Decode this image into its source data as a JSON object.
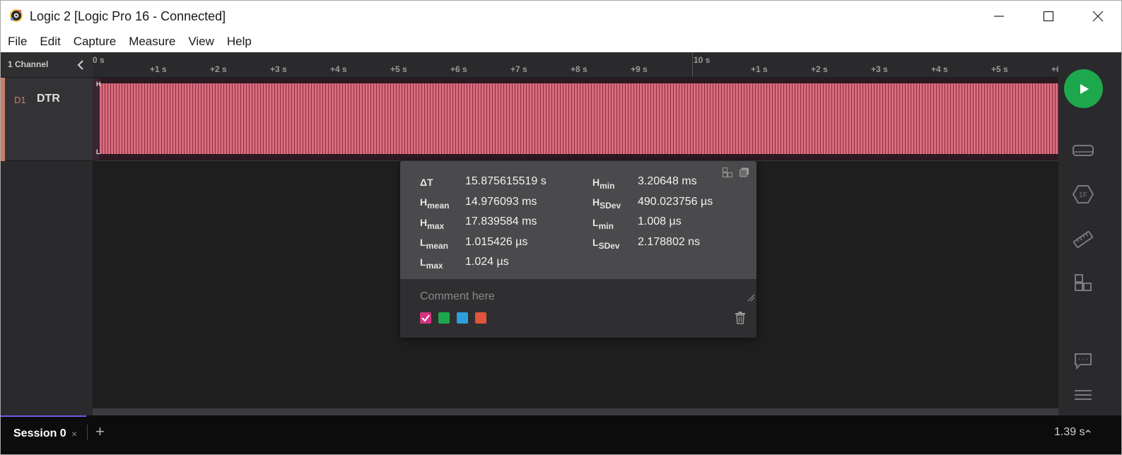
{
  "window": {
    "title": "Logic 2 [Logic Pro 16 - Connected]"
  },
  "menu": [
    "File",
    "Edit",
    "Capture",
    "Measure",
    "View",
    "Help"
  ],
  "channels": {
    "count_label": "1 Channel",
    "items": [
      {
        "number": "D1",
        "name": "DTR",
        "color": "#c97f6b"
      }
    ]
  },
  "timeline": {
    "origin_label": "0 s",
    "ticks_a": [
      "+1 s",
      "+2 s",
      "+3 s",
      "+4 s",
      "+5 s",
      "+6 s",
      "+7 s",
      "+8 s",
      "+9 s"
    ],
    "major_label": "10 s",
    "ticks_b": [
      "+1 s",
      "+2 s",
      "+3 s",
      "+4 s",
      "+5 s",
      "+6"
    ]
  },
  "waveform": {
    "high_marker": "H",
    "low_marker": "L",
    "color": "#d96c7e"
  },
  "measurement": {
    "left": [
      {
        "label": "ΔT",
        "sub": "",
        "value": "15.875615519 s"
      },
      {
        "label": "H",
        "sub": "mean",
        "value": "14.976093 ms"
      },
      {
        "label": "H",
        "sub": "max",
        "value": "17.839584 ms"
      },
      {
        "label": "L",
        "sub": "mean",
        "value": "1.015426 µs"
      },
      {
        "label": "L",
        "sub": "max",
        "value": "1.024 µs"
      }
    ],
    "right": [
      {
        "label": "H",
        "sub": "min",
        "value": "3.20648 ms"
      },
      {
        "label": "H",
        "sub": "SDev",
        "value": "490.023756 µs"
      },
      {
        "label": "L",
        "sub": "min",
        "value": "1.008 µs"
      },
      {
        "label": "L",
        "sub": "SDev",
        "value": "2.178802 ns"
      }
    ],
    "comment_placeholder": "Comment here",
    "swatches": [
      "#d6337f",
      "#1ea84e",
      "#2d9fdb",
      "#e0533d"
    ]
  },
  "session": {
    "tab_label": "Session 0",
    "close_glyph": "×",
    "add_glyph": "+",
    "duration": "1.39 s"
  }
}
